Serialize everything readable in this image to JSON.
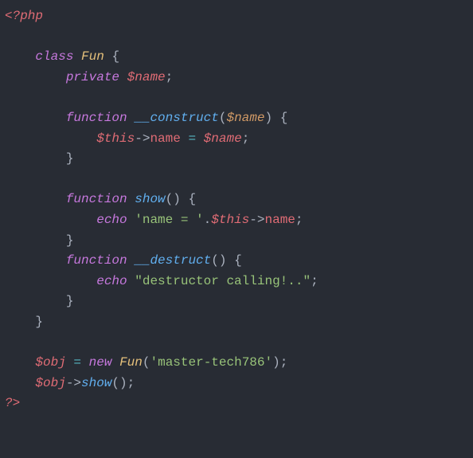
{
  "tokens": {
    "open_tag": "<?php",
    "close_tag": "?>",
    "kw_class": "class",
    "cls_name": "Fun",
    "brace_open": "{",
    "brace_close": "}",
    "kw_private": "private",
    "var_name": "$name",
    "semicolon": ";",
    "kw_function": "function",
    "fn_construct": "__construct",
    "paren_open": "(",
    "paren_close": ")",
    "param_name": "$name",
    "var_this": "$this",
    "arrow": "->",
    "prop_name": "name",
    "op_assign": "=",
    "fn_show": "show",
    "kw_echo": "echo",
    "str_name_eq": "'name = '",
    "dot": ".",
    "fn_destruct": "__destruct",
    "str_destruct": "\"destructor calling!..\"",
    "var_obj": "$obj",
    "kw_new": "new",
    "str_master": "'master-tech786'",
    "comma": ","
  }
}
